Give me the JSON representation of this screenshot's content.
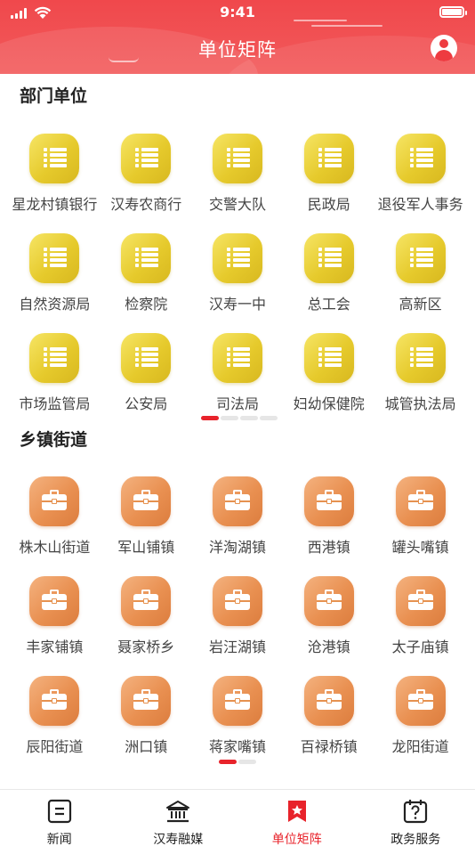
{
  "status_bar": {
    "time": "9:41"
  },
  "header": {
    "title": "单位矩阵",
    "avatar_icon": "user-avatar-icon"
  },
  "departments": {
    "title": "部门单位",
    "icon": "list-icon",
    "color": "#e6ca2c",
    "items": [
      {
        "label": "星龙村镇银行"
      },
      {
        "label": "汉寿农商行"
      },
      {
        "label": "交警大队"
      },
      {
        "label": "民政局"
      },
      {
        "label": "退役军人事务"
      },
      {
        "label": "自然资源局"
      },
      {
        "label": "检察院"
      },
      {
        "label": "汉寿一中"
      },
      {
        "label": "总工会"
      },
      {
        "label": "高新区"
      },
      {
        "label": "市场监管局"
      },
      {
        "label": "公安局"
      },
      {
        "label": "司法局"
      },
      {
        "label": "妇幼保健院"
      },
      {
        "label": "城管执法局"
      }
    ],
    "pager": {
      "pages": 4,
      "current": 1
    }
  },
  "towns": {
    "title": "乡镇街道",
    "icon": "briefcase-icon",
    "color": "#e99051",
    "items": [
      {
        "label": "株木山街道"
      },
      {
        "label": "军山铺镇"
      },
      {
        "label": "洋淘湖镇"
      },
      {
        "label": "西港镇"
      },
      {
        "label": "罐头嘴镇"
      },
      {
        "label": "丰家铺镇"
      },
      {
        "label": "聂家桥乡"
      },
      {
        "label": "岩汪湖镇"
      },
      {
        "label": "沧港镇"
      },
      {
        "label": "太子庙镇"
      },
      {
        "label": "辰阳街道"
      },
      {
        "label": "洲口镇"
      },
      {
        "label": "蒋家嘴镇"
      },
      {
        "label": "百禄桥镇"
      },
      {
        "label": "龙阳街道"
      }
    ],
    "pager": {
      "pages": 2,
      "current": 1
    }
  },
  "tabbar": {
    "accent": "#e8232b",
    "tabs": [
      {
        "label": "新闻",
        "icon": "news-icon",
        "active": false
      },
      {
        "label": "汉寿融媒",
        "icon": "bank-icon",
        "active": false
      },
      {
        "label": "单位矩阵",
        "icon": "bookmark-star-icon",
        "active": true
      },
      {
        "label": "政务服务",
        "icon": "calendar-question-icon",
        "active": false
      }
    ]
  }
}
